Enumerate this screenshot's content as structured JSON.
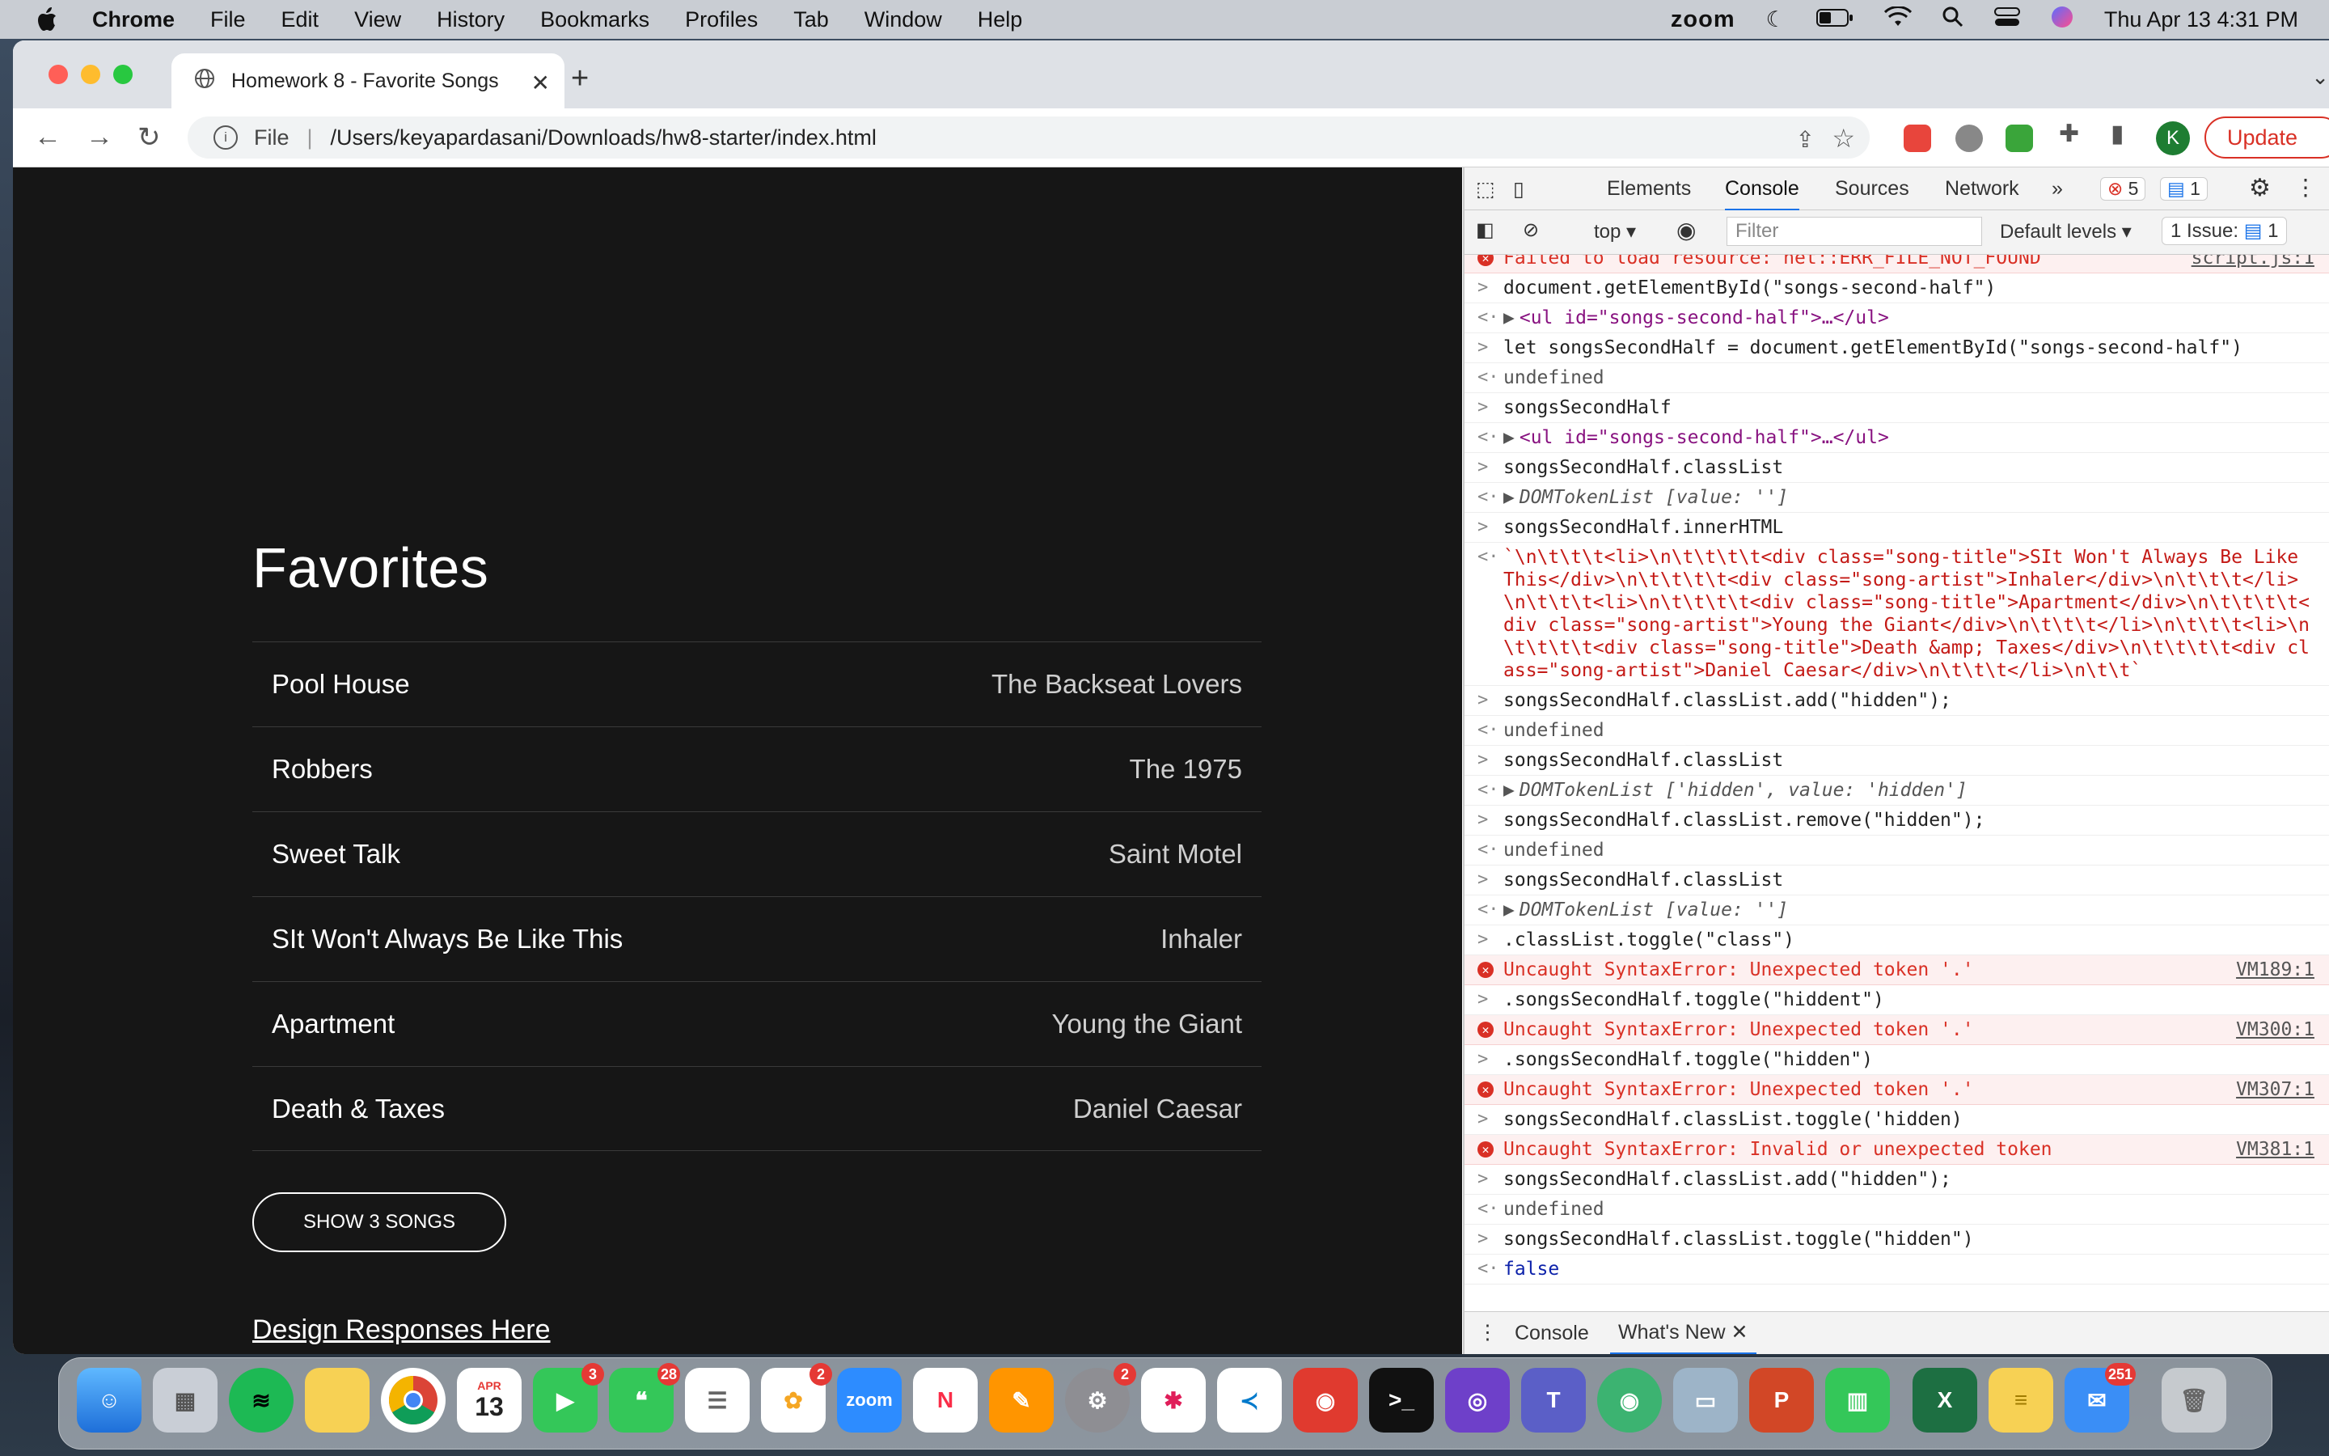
{
  "menubar": {
    "app_name": "Chrome",
    "items": [
      "File",
      "Edit",
      "View",
      "History",
      "Bookmarks",
      "Profiles",
      "Tab",
      "Window",
      "Help"
    ],
    "zoom_label": "zoom",
    "datetime": "Thu Apr 13  4:31 PM"
  },
  "browser": {
    "tab_title": "Homework 8 - Favorite Songs",
    "url_scheme": "File",
    "url_path": "/Users/keyapardasani/Downloads/hw8-starter/index.html",
    "profile_initial": "K",
    "update_label": "Update"
  },
  "page": {
    "heading": "Favorites",
    "songs": [
      {
        "title": "Pool House",
        "artist": "The Backseat Lovers"
      },
      {
        "title": "Robbers",
        "artist": "The 1975"
      },
      {
        "title": "Sweet Talk",
        "artist": "Saint Motel"
      },
      {
        "title": "SIt Won't Always Be Like This",
        "artist": "Inhaler"
      },
      {
        "title": "Apartment",
        "artist": "Young the Giant"
      },
      {
        "title": "Death & Taxes",
        "artist": "Daniel Caesar"
      }
    ],
    "show_button": "SHOW 3 SONGS",
    "design_link": "Design Responses Here"
  },
  "devtools": {
    "tabs": [
      "Elements",
      "Console",
      "Sources",
      "Network"
    ],
    "more": "»",
    "error_count": "5",
    "info_count": "1",
    "context": "top",
    "filter_placeholder": "Filter",
    "levels": "Default levels",
    "issues": "1 Issue:",
    "issues_count": "1",
    "console": {
      "top_error": "Failed to load resource: net::ERR_FILE_NOT_FOUND",
      "top_error_src": "script.js:1",
      "l1": "document.getElementById(\"songs-second-half\")",
      "r1": "<ul id=\"songs-second-half\">…</ul>",
      "l2": "let songsSecondHalf = document.getElementById(\"songs-second-half\")",
      "undefined": "undefined",
      "l3": "songsSecondHalf",
      "l4": "songsSecondHalf.classList",
      "r4": "DOMTokenList [value: '']",
      "l5": "songsSecondHalf.innerHTML",
      "r5": "`\\n\\t\\t\\t<li>\\n\\t\\t\\t\\t<div class=\"song-title\">SIt Won't Always Be Like This</div>\\n\\t\\t\\t\\t<div class=\"song-artist\">Inhaler</div>\\n\\t\\t\\t</li>\\n\\t\\t\\t<li>\\n\\t\\t\\t\\t<div class=\"song-title\">Apartment</div>\\n\\t\\t\\t\\t<div class=\"song-artist\">Young the Giant</div>\\n\\t\\t\\t</li>\\n\\t\\t\\t<li>\\n\\t\\t\\t\\t<div class=\"song-title\">Death &amp; Taxes</div>\\n\\t\\t\\t\\t<div class=\"song-artist\">Daniel Caesar</div>\\n\\t\\t\\t</li>\\n\\t\\t`",
      "l6": "songsSecondHalf.classList.add(\"hidden\");",
      "r7": "DOMTokenList ['hidden', value: 'hidden']",
      "l8": "songsSecondHalf.classList.remove(\"hidden\");",
      "l10": ".classList.toggle(\"class\")",
      "e1": "Uncaught SyntaxError: Unexpected token '.'",
      "e1_src": "VM189:1",
      "l11": ".songsSecondHalf.toggle(\"hiddent\")",
      "e2_src": "VM300:1",
      "l12": ".songsSecondHalf.toggle(\"hidden\")",
      "e3_src": "VM307:1",
      "l13": "songsSecondHalf.classList.toggle('hidden)",
      "e4": "Uncaught SyntaxError: Invalid or unexpected token",
      "e4_src": "VM381:1",
      "l15": "songsSecondHalf.classList.toggle(\"hidden\")",
      "r15": "false"
    },
    "drawer_tabs": [
      "Console",
      "What's New"
    ]
  },
  "dock": {
    "badges": {
      "facetime": "3",
      "messages": "28",
      "photos": "2",
      "settings": "2",
      "mail": "251"
    },
    "calendar_month": "APR",
    "calendar_day": "13",
    "zoom_label": "zoom"
  },
  "colors": {
    "accent": "#1a73e8",
    "error": "#d93025",
    "page_bg": "#161616"
  }
}
